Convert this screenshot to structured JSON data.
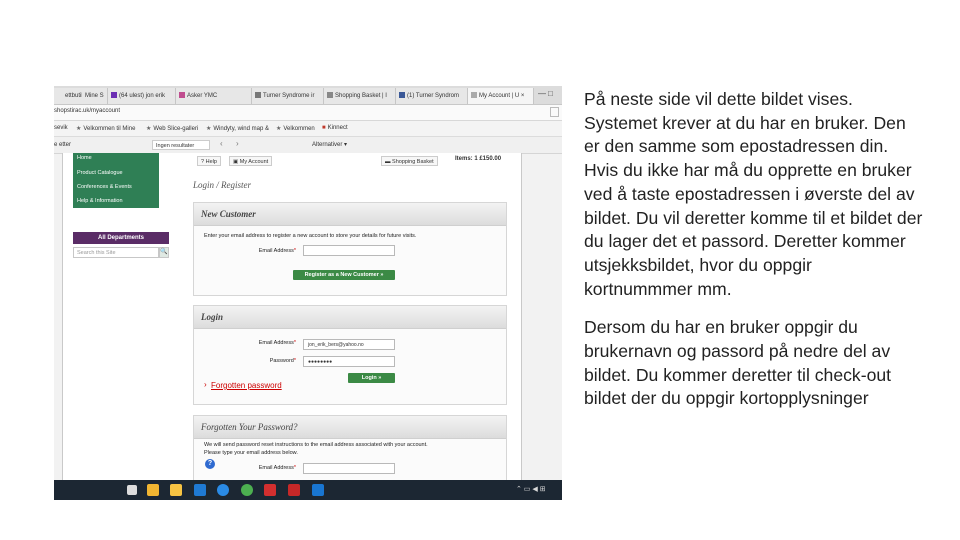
{
  "browser": {
    "tabs": [
      {
        "label": "ettbutikk",
        "icon_color": "#2b7bd1"
      },
      {
        "label": "Mine S",
        "icon_color": "#888888"
      },
      {
        "label": "(64 ulest) jon erik",
        "icon_color": "#6b2fb3"
      },
      {
        "label": "Asker YMC",
        "icon_color": "#c04d8f"
      },
      {
        "label": "Turner Syndrome ir",
        "icon_color": "#777777"
      },
      {
        "label": "Shopping Basket | I",
        "icon_color": "#888888"
      },
      {
        "label": "(1) Turner Syndrom",
        "icon_color": "#3b5998"
      },
      {
        "label": "My Account | U",
        "icon_color": "#888888",
        "close": "×"
      }
    ],
    "window_controls": {
      "minimize": "—",
      "restore": "□",
      "close": "×"
    },
    "address": "shopstirac.uk/myaccount",
    "bookmarks": [
      {
        "label": "sevik"
      },
      {
        "label": "Velkommen til Mine"
      },
      {
        "label": "Web Slice-galleri"
      },
      {
        "label": "Windyty, wind map &"
      },
      {
        "label": "Velkommen"
      },
      {
        "label": "Kinnect"
      }
    ],
    "find": {
      "text": "e etter",
      "result": "Ingen resultater",
      "prev": "‹",
      "next": "›",
      "options": "Alternativer ▾"
    }
  },
  "site": {
    "menu": [
      "Home",
      "Product Catalogue",
      "Conferences & Events",
      "Help & Information"
    ],
    "all_departments": "All Departments",
    "search_placeholder": "Search this Site",
    "search_go": "🔍",
    "top_links": {
      "help": "Help",
      "account": "My Account",
      "basket": "Shopping Basket",
      "items": "Items: 1 £150.00"
    },
    "page_title": "Login / Register",
    "new_customer": {
      "title": "New Customer",
      "instructions": "Enter your email address to register a new account to store your details for future visits.",
      "email_label": "Email Address",
      "required_mark": "*",
      "button": "Register as a New Customer »"
    },
    "login": {
      "title": "Login",
      "email_label": "Email Address",
      "email_value": "jon_erik_bers@yahoo.no",
      "password_label": "Password",
      "password_value": "●●●●●●●●",
      "button": "Login »",
      "forgotten_link": "Forgotten password",
      "bullet": "›"
    },
    "forgotten": {
      "title": "Forgotten Your Password?",
      "line1": "We will send password reset instructions to the email address associated with your account.",
      "line2": "Please type your email address below.",
      "help": "?",
      "email_label": "Email Address"
    }
  },
  "taskbar": {
    "icons": [
      {
        "name": "start",
        "color": "#dddddd"
      },
      {
        "name": "store",
        "color": "#f2b632"
      },
      {
        "name": "explorer",
        "color": "#f6c343"
      },
      {
        "name": "mail",
        "color": "#1f7ad4"
      },
      {
        "name": "edge",
        "color": "#2a8be6"
      },
      {
        "name": "chrome",
        "color": "#4caf50"
      },
      {
        "name": "acrobat",
        "color": "#d32f2f"
      },
      {
        "name": "filezilla",
        "color": "#c62828"
      },
      {
        "name": "outlook",
        "color": "#1976d2"
      }
    ],
    "tray": "⌃ ▭ ◀ ⊞"
  },
  "notes": {
    "paragraph1": "På neste side vil dette bildet vises. Systemet krever at du har en bruker. Den er den samme som epostadressen din. Hvis du ikke har må du opprette en bruker ved å taste epostadressen i øverste del av bildet. Du vil deretter komme til et bildet der du lager det et passord. Deretter kommer utsjekksbildet, hvor du oppgir kortnummmer mm.",
    "paragraph2": "Dersom du har en bruker oppgir du brukernavn og passord på nedre del av bildet. Du kommer deretter til check-out bildet der du oppgir kortopplysninger"
  }
}
